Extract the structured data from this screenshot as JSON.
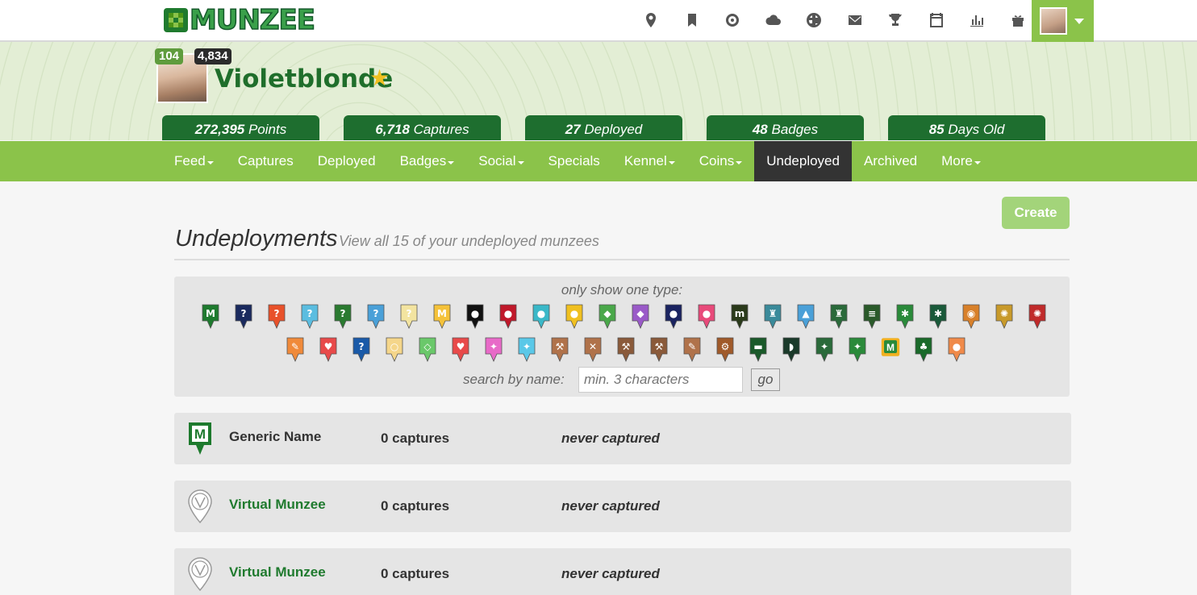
{
  "brand": {
    "logo_text": "MUNZEE"
  },
  "top_icons": [
    "map-pin-icon",
    "bookmark-icon",
    "target-icon",
    "cloud-icon",
    "globe-icon",
    "envelope-icon",
    "trophy-icon",
    "calendar-icon",
    "bar-chart-icon",
    "gift-icon"
  ],
  "profile": {
    "level": "104",
    "rank": "4,834",
    "username": "Violetblonde",
    "stats": [
      {
        "value": "272,395",
        "label": "Points"
      },
      {
        "value": "6,718",
        "label": "Captures"
      },
      {
        "value": "27",
        "label": "Deployed"
      },
      {
        "value": "48",
        "label": "Badges"
      },
      {
        "value": "85",
        "label": "Days Old"
      }
    ]
  },
  "nav": [
    {
      "label": "Feed",
      "dropdown": true
    },
    {
      "label": "Captures",
      "dropdown": false
    },
    {
      "label": "Deployed",
      "dropdown": false
    },
    {
      "label": "Badges",
      "dropdown": true
    },
    {
      "label": "Social",
      "dropdown": true
    },
    {
      "label": "Specials",
      "dropdown": false
    },
    {
      "label": "Kennel",
      "dropdown": true
    },
    {
      "label": "Coins",
      "dropdown": true
    },
    {
      "label": "Undeployed",
      "dropdown": false,
      "active": true
    },
    {
      "label": "Archived",
      "dropdown": false
    },
    {
      "label": "More",
      "dropdown": true
    }
  ],
  "main": {
    "create_label": "Create",
    "title": "Undeployments",
    "subtitle": "View all 15 of your undeployed munzees"
  },
  "filter": {
    "label": "only show one type:",
    "search_label": "search by name:",
    "search_placeholder": "min. 3 characters",
    "go_label": "go",
    "types_row1": [
      {
        "icon": "munzee-pin-icon",
        "color": "#1e7a2e",
        "glyph": "M"
      },
      {
        "icon": "mystery-pin-icon",
        "color": "#1a2a5e",
        "glyph": "?"
      },
      {
        "icon": "mystery-pin-icon",
        "color": "#e8512a",
        "glyph": "?"
      },
      {
        "icon": "mystery-pin-icon",
        "color": "#5bbde0",
        "glyph": "?"
      },
      {
        "icon": "mystery-pin-icon",
        "color": "#2a7a30",
        "glyph": "?"
      },
      {
        "icon": "mystery-pin-icon",
        "color": "#4aa0d8",
        "glyph": "?"
      },
      {
        "icon": "mystery-pin-icon",
        "color": "#f3e4a0",
        "glyph": "?"
      },
      {
        "icon": "munzee-pin-icon",
        "color": "#f5c23a",
        "glyph": "M"
      },
      {
        "icon": "circle-pin-icon",
        "color": "#111111",
        "glyph": "●"
      },
      {
        "icon": "circle-pin-icon",
        "color": "#c0182a",
        "glyph": "●"
      },
      {
        "icon": "circle-pin-icon",
        "color": "#3ab8c8",
        "glyph": "●"
      },
      {
        "icon": "circle-pin-icon",
        "color": "#f0c020",
        "glyph": "●"
      },
      {
        "icon": "gem-pin-icon",
        "color": "#4aa84a",
        "glyph": "◆"
      },
      {
        "icon": "gem-pin-icon",
        "color": "#9a5ac8",
        "glyph": "◆"
      },
      {
        "icon": "circle-pin-icon",
        "color": "#1a2360",
        "glyph": "●"
      },
      {
        "icon": "circle-pin-icon",
        "color": "#e84a7a",
        "glyph": "●"
      },
      {
        "icon": "munzee-pin-icon",
        "color": "#2a3a1a",
        "glyph": "m"
      },
      {
        "icon": "castle-pin-icon",
        "color": "#3a8a9a",
        "glyph": "♜"
      },
      {
        "icon": "balloon-pin-icon",
        "color": "#4aa0d8",
        "glyph": "▲"
      },
      {
        "icon": "castle-pin-icon",
        "color": "#2a6a3a",
        "glyph": "♜"
      },
      {
        "icon": "trail-pin-icon",
        "color": "#2a5a2a",
        "glyph": "≡"
      },
      {
        "icon": "star-pin-icon",
        "color": "#2a8a3a",
        "glyph": "✱"
      },
      {
        "icon": "star-pin-icon",
        "color": "#1a5a3a",
        "glyph": "✱"
      },
      {
        "icon": "eye-pin-icon",
        "color": "#d8802a",
        "glyph": "◉"
      },
      {
        "icon": "web-pin-icon",
        "color": "#c89a2a",
        "glyph": "✺"
      },
      {
        "icon": "web-pin-icon",
        "color": "#c02a2a",
        "glyph": "✺"
      }
    ],
    "types_row2": [
      {
        "icon": "feather-pin-icon",
        "color": "#f08a3a",
        "glyph": "✎"
      },
      {
        "icon": "rainbow-pin-icon",
        "color": "#e84a4a",
        "glyph": "♥"
      },
      {
        "icon": "mystery-pin-icon",
        "color": "#1a5aa8",
        "glyph": "?"
      },
      {
        "icon": "bulb-pin-icon",
        "color": "#f5d68a",
        "glyph": "○"
      },
      {
        "icon": "diamond-pin-icon",
        "color": "#6ac86a",
        "glyph": "◇"
      },
      {
        "icon": "flame-pin-icon",
        "color": "#e84a4a",
        "glyph": "♥"
      },
      {
        "icon": "unicorn-pin-icon",
        "color": "#e86ac8",
        "glyph": "✦"
      },
      {
        "icon": "unicorn-pin-icon",
        "color": "#5ac8e8",
        "glyph": "✦"
      },
      {
        "icon": "tool-pin-icon",
        "color": "#b0724a",
        "glyph": "⚒"
      },
      {
        "icon": "tool-pin-icon",
        "color": "#b0724a",
        "glyph": "✕"
      },
      {
        "icon": "tool-pin-icon",
        "color": "#8a5a3a",
        "glyph": "⚒"
      },
      {
        "icon": "tool-pin-icon",
        "color": "#8a5a3a",
        "glyph": "⚒"
      },
      {
        "icon": "tool-pin-icon",
        "color": "#b0724a",
        "glyph": "✎"
      },
      {
        "icon": "tool-pin-icon",
        "color": "#a05a2a",
        "glyph": "⚙"
      },
      {
        "icon": "car-pin-icon",
        "color": "#1a5a2a",
        "glyph": "▬"
      },
      {
        "icon": "mask-pin-icon",
        "color": "#1a3a2a",
        "glyph": "◗"
      },
      {
        "icon": "walker-pin-icon",
        "color": "#2a6a3a",
        "glyph": "✦"
      },
      {
        "icon": "walker-pin-icon",
        "color": "#2a8a3a",
        "glyph": "✦"
      },
      {
        "icon": "munzee-square-icon",
        "color": "#f0b020",
        "glyph": "M"
      },
      {
        "icon": "clover-pin-icon",
        "color": "#1a6a2a",
        "glyph": "♣"
      },
      {
        "icon": "badge-pin-icon",
        "color": "#f08a4a",
        "glyph": "●"
      }
    ]
  },
  "rows": [
    {
      "name": "Generic Name",
      "captures": "0 captures",
      "last": "never captured",
      "icon": "munzee-green-icon",
      "link": false
    },
    {
      "name": "Virtual Munzee",
      "captures": "0 captures",
      "last": "never captured",
      "icon": "virtual-munzee-icon",
      "link": true
    },
    {
      "name": "Virtual Munzee",
      "captures": "0 captures",
      "last": "never captured",
      "icon": "virtual-munzee-icon",
      "link": true
    }
  ]
}
